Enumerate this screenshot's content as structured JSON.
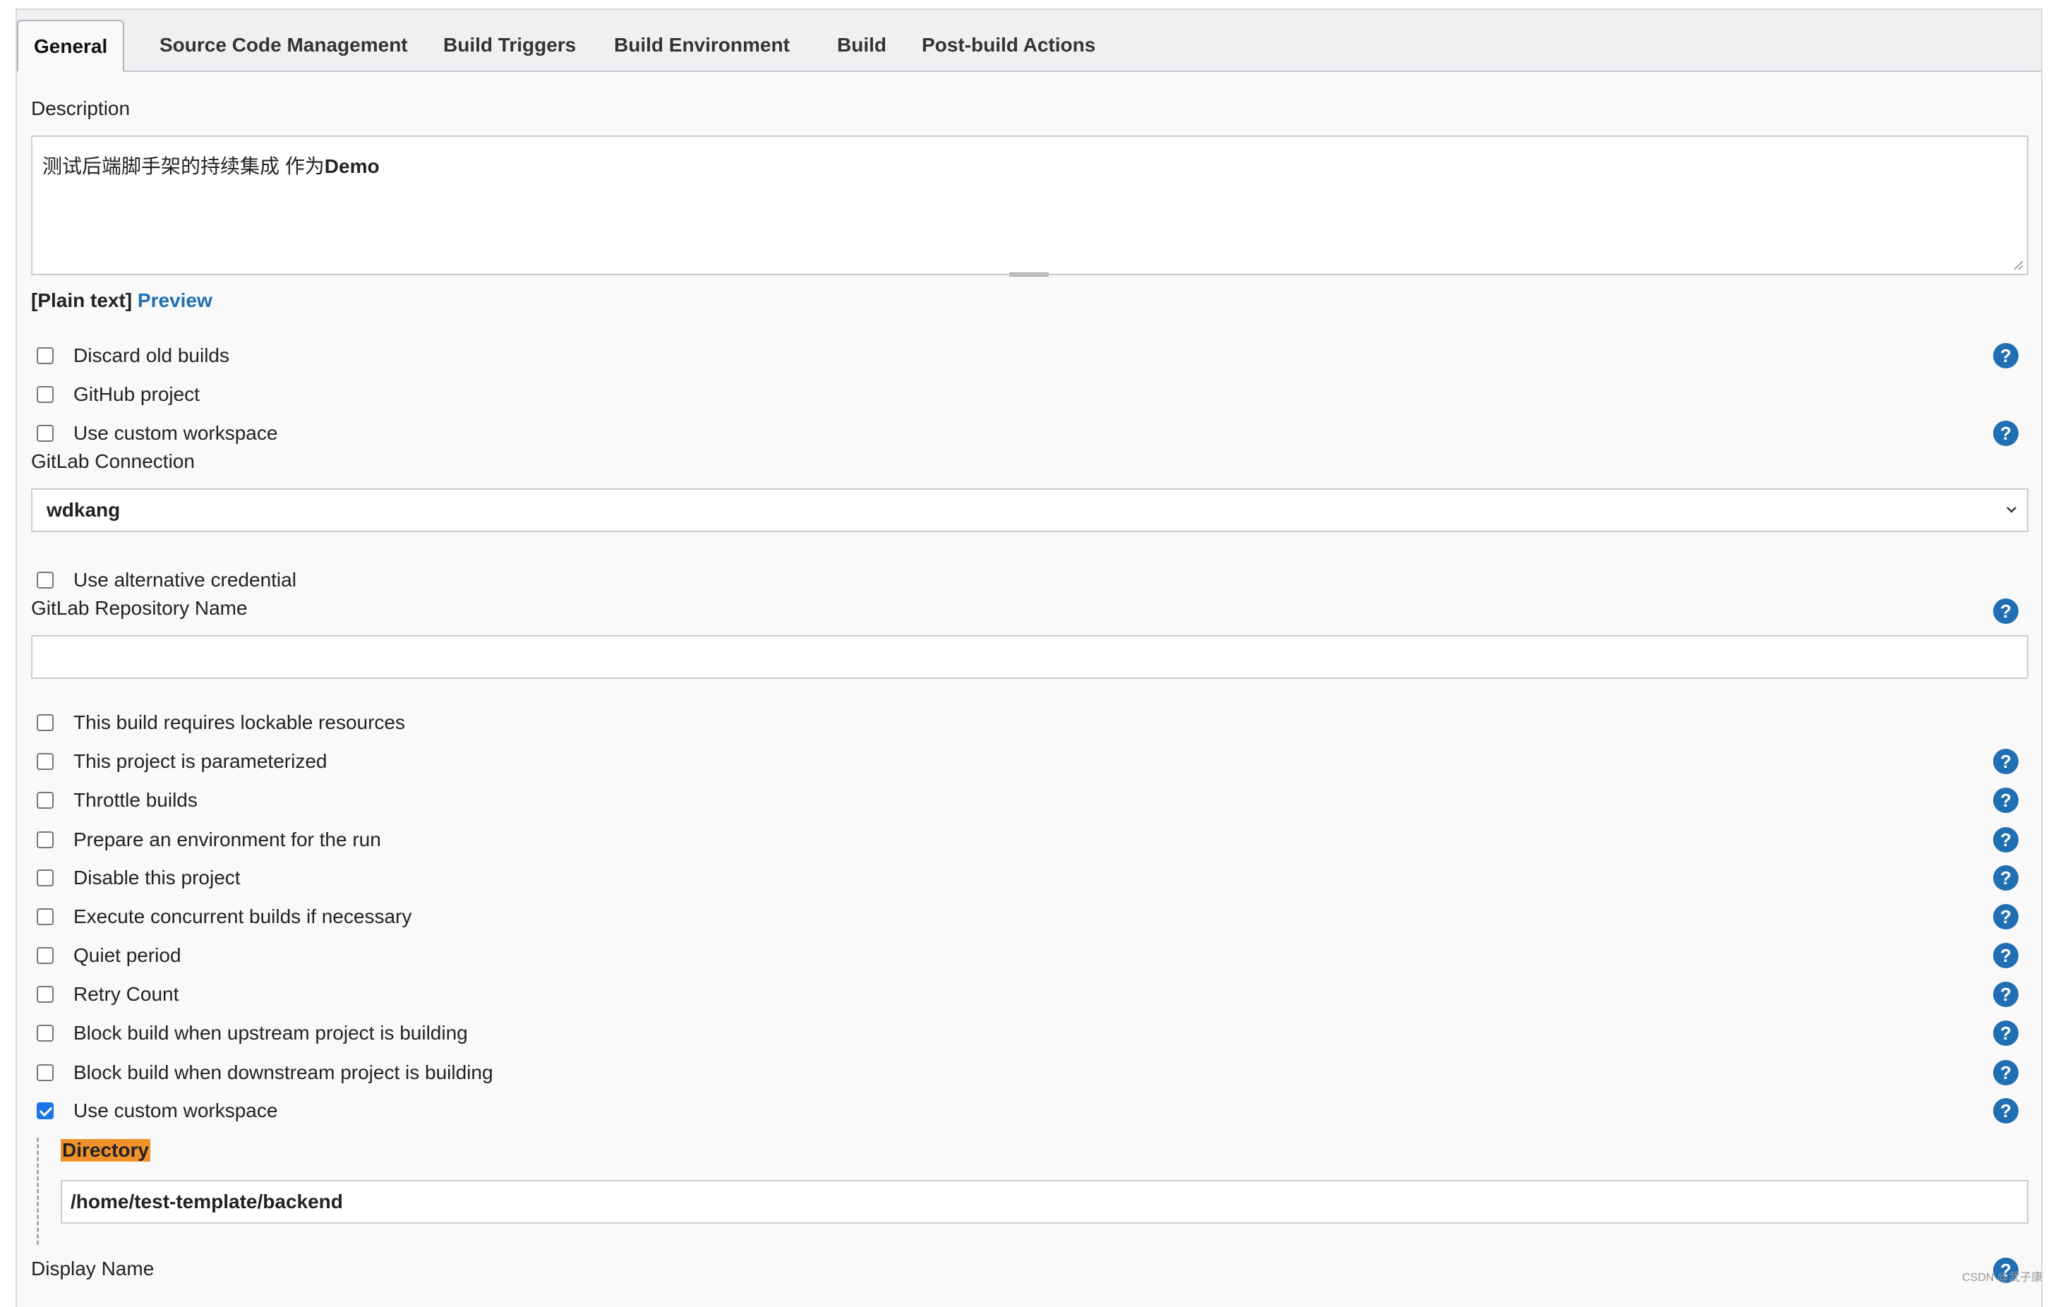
{
  "tabs": [
    {
      "label": "General",
      "active": true
    },
    {
      "label": "Source Code Management"
    },
    {
      "label": "Build Triggers"
    },
    {
      "label": "Build Environment"
    },
    {
      "label": "Build"
    },
    {
      "label": "Post-build Actions"
    }
  ],
  "description": {
    "label": "Description",
    "value_prefix": "测试后端脚手架的持续集成 作为",
    "value_bold": "Demo",
    "plain_text": "[Plain text]",
    "preview": "Preview"
  },
  "options_top": [
    {
      "label": "Discard old builds",
      "checked": false,
      "help": true
    },
    {
      "label": "GitHub project",
      "checked": false,
      "help": false
    },
    {
      "label": "Use custom workspace",
      "checked": false,
      "help": true
    }
  ],
  "gitlab_connection": {
    "label": "GitLab Connection",
    "value": "wdkang"
  },
  "alt_credential": {
    "label": "Use alternative credential",
    "checked": false
  },
  "gitlab_repo": {
    "label": "GitLab Repository Name",
    "value": ""
  },
  "options": [
    {
      "label": "This build requires lockable resources",
      "checked": false,
      "help": false
    },
    {
      "label": "This project is parameterized",
      "checked": false,
      "help": true
    },
    {
      "label": "Throttle builds",
      "checked": false,
      "help": true
    },
    {
      "label": "Prepare an environment for the run",
      "checked": false,
      "help": true
    },
    {
      "label": "Disable this project",
      "checked": false,
      "help": true
    },
    {
      "label": "Execute concurrent builds if necessary",
      "checked": false,
      "help": true
    },
    {
      "label": "Quiet period",
      "checked": false,
      "help": true
    },
    {
      "label": "Retry Count",
      "checked": false,
      "help": true
    },
    {
      "label": "Block build when upstream project is building",
      "checked": false,
      "help": true
    },
    {
      "label": "Block build when downstream project is building",
      "checked": false,
      "help": true
    },
    {
      "label": "Use custom workspace",
      "checked": true,
      "help": true
    }
  ],
  "directory": {
    "label": "Directory",
    "value": "/home/test-template/backend"
  },
  "display_name": {
    "label": "Display Name"
  },
  "help_glyph": "?",
  "watermark": "CSDN @武子康",
  "colors": {
    "accent": "#1f6fb2",
    "highlight": "#f0922b",
    "checkbox_checked": "#1a73e8"
  }
}
